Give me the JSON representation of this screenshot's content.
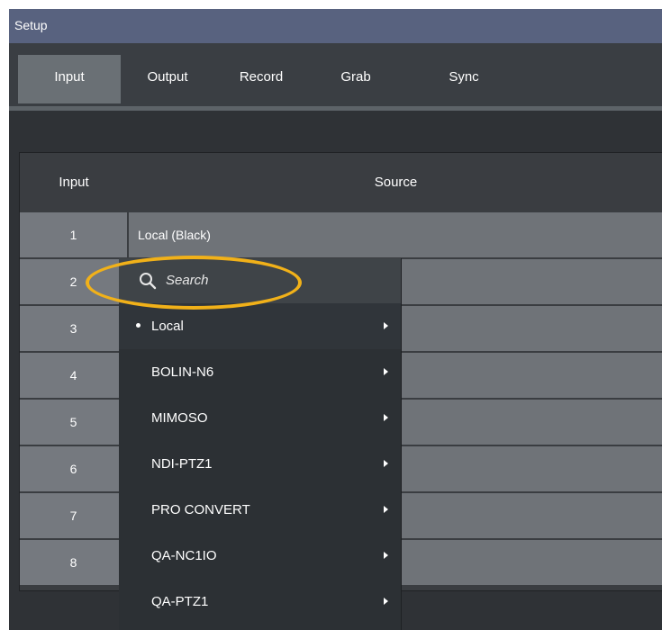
{
  "window": {
    "title": "Setup"
  },
  "tabs": [
    {
      "label": "Input",
      "active": true
    },
    {
      "label": "Output",
      "active": false
    },
    {
      "label": "Record",
      "active": false
    },
    {
      "label": "Grab",
      "active": false
    },
    {
      "label": "Sync",
      "active": false
    }
  ],
  "table": {
    "columns": {
      "input": "Input",
      "source": "Source"
    },
    "rows": [
      {
        "input": "1",
        "source": "Local (Black)"
      },
      {
        "input": "2",
        "source": ""
      },
      {
        "input": "3",
        "source": ""
      },
      {
        "input": "4",
        "source": ""
      },
      {
        "input": "5",
        "source": ""
      },
      {
        "input": "6",
        "source": ""
      },
      {
        "input": "7",
        "source": ""
      },
      {
        "input": "8",
        "source": ""
      }
    ]
  },
  "dropdown": {
    "search_placeholder": "Search",
    "items": [
      {
        "label": "Local",
        "selected": true
      },
      {
        "label": "BOLIN-N6",
        "selected": false
      },
      {
        "label": "MIMOSO",
        "selected": false
      },
      {
        "label": "NDI-PTZ1",
        "selected": false
      },
      {
        "label": "PRO CONVERT",
        "selected": false
      },
      {
        "label": "QA-NC1IO",
        "selected": false
      },
      {
        "label": "QA-PTZ1",
        "selected": false
      }
    ]
  },
  "colors": {
    "titlebar": "#58627f",
    "highlight": "#f1b119"
  },
  "icons": {
    "search": "search-icon",
    "submenu": "chevron-right-icon"
  }
}
